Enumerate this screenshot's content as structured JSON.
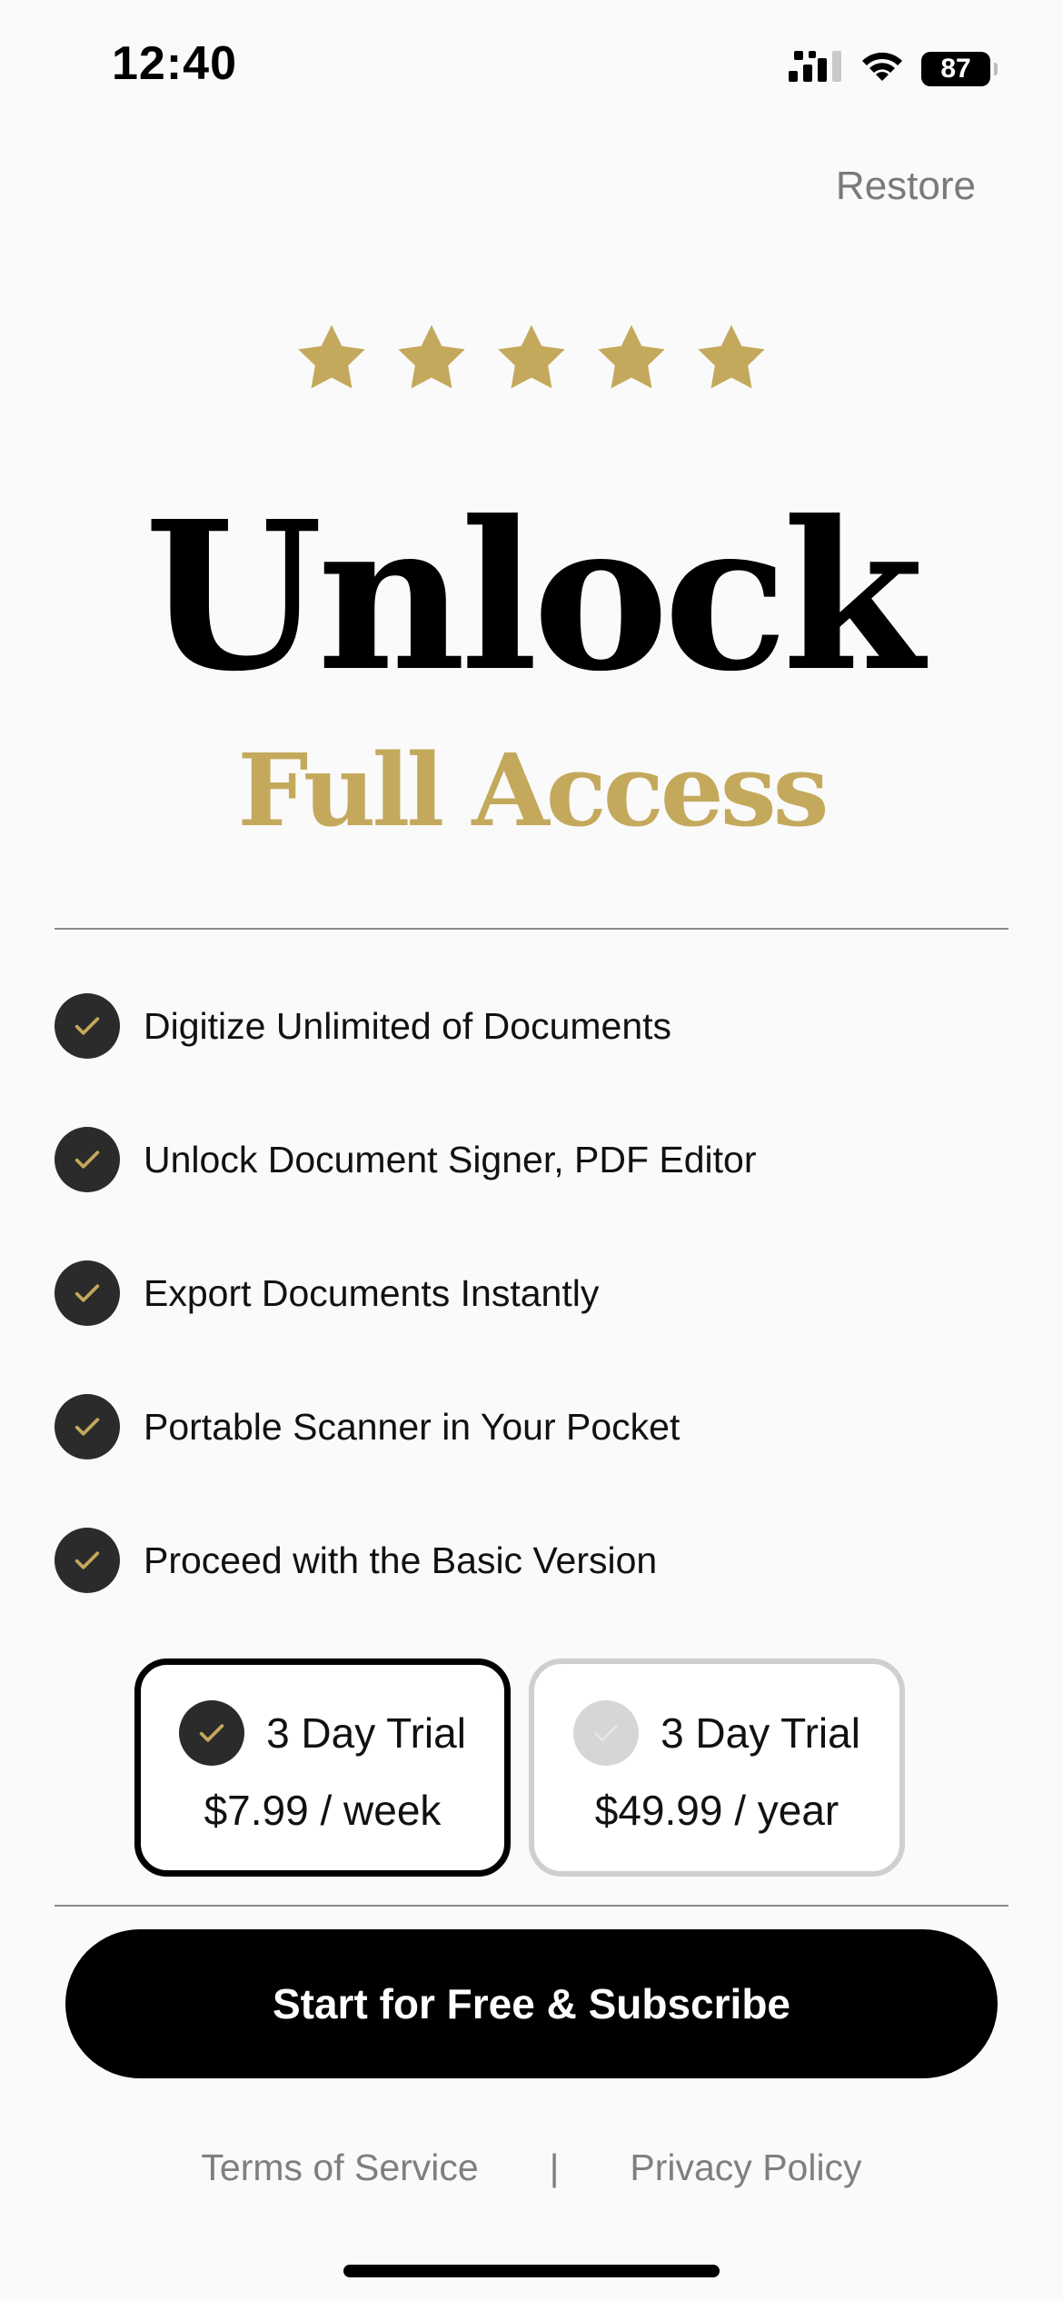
{
  "status_bar": {
    "time": "12:40",
    "battery": "87",
    "icons": [
      "signal-icon",
      "wifi-icon",
      "battery-icon"
    ]
  },
  "header": {
    "restore_label": "Restore"
  },
  "hero": {
    "rating_stars": 5,
    "title": "Unlock",
    "subtitle": "Full Access"
  },
  "features": [
    {
      "label": "Digitize Unlimited of Documents",
      "icon": "check-icon"
    },
    {
      "label": "Unlock Document Signer, PDF Editor",
      "icon": "check-icon"
    },
    {
      "label": "Export Documents Instantly",
      "icon": "check-icon"
    },
    {
      "label": "Portable Scanner in Your Pocket",
      "icon": "check-icon"
    },
    {
      "label": "Proceed with the Basic Version",
      "icon": "check-icon"
    }
  ],
  "plans": [
    {
      "name": "3 Day Trial",
      "price": "$7.99 / week",
      "selected": true
    },
    {
      "name": "3 Day Trial",
      "price": "$49.99 / year",
      "selected": false
    }
  ],
  "cta": {
    "label": "Start for Free & Subscribe"
  },
  "footer": {
    "terms": "Terms of Service",
    "separator": "|",
    "privacy": "Privacy Policy"
  },
  "colors": {
    "accent_gold": "#c4a95c",
    "dark_badge": "#2b2b2b",
    "background": "#fafafa",
    "muted_text": "#7f7f7f"
  }
}
